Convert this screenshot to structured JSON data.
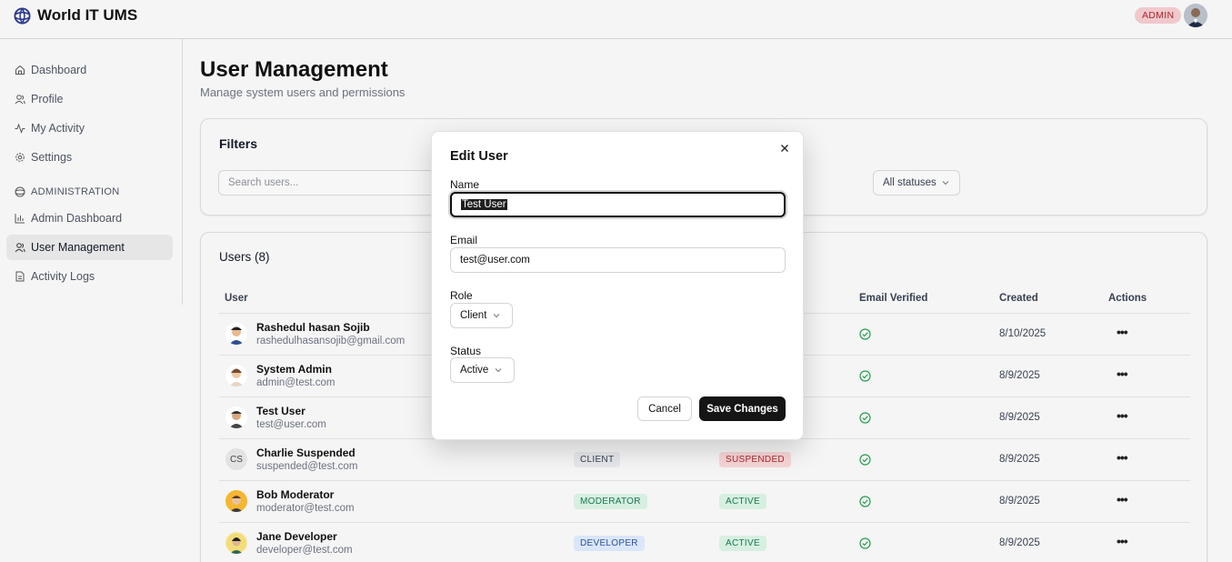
{
  "header": {
    "app_name": "World IT UMS",
    "role_badge": "ADMIN"
  },
  "sidebar": {
    "items": [
      {
        "label": "Dashboard"
      },
      {
        "label": "Profile"
      },
      {
        "label": "My Activity"
      },
      {
        "label": "Settings"
      }
    ],
    "section_label": "ADMINISTRATION",
    "admin_items": [
      {
        "label": "Admin Dashboard"
      },
      {
        "label": "User Management"
      },
      {
        "label": "Activity Logs"
      }
    ]
  },
  "main": {
    "title": "User Management",
    "subtitle": "Manage system users and permissions",
    "filters": {
      "title": "Filters",
      "search_placeholder": "Search users...",
      "status_value": "All statuses"
    },
    "users": {
      "title": "Users (8)",
      "columns": {
        "user": "User",
        "email_verified": "Email Verified",
        "created": "Created",
        "actions": "Actions"
      },
      "rows": [
        {
          "name": "Rashedul hasan Sojib",
          "email": "rashedulhasansojib@gmail.com",
          "role": "",
          "status": "",
          "created": "8/10/2025"
        },
        {
          "name": "System Admin",
          "email": "admin@test.com",
          "role": "",
          "status": "",
          "created": "8/9/2025"
        },
        {
          "name": "Test User",
          "email": "test@user.com",
          "role": "",
          "status": "",
          "created": "8/9/2025"
        },
        {
          "name": "Charlie Suspended",
          "email": "suspended@test.com",
          "initials": "CS",
          "role": "CLIENT",
          "status": "SUSPENDED",
          "created": "8/9/2025"
        },
        {
          "name": "Bob Moderator",
          "email": "moderator@test.com",
          "role": "MODERATOR",
          "status": "ACTIVE",
          "created": "8/9/2025"
        },
        {
          "name": "Jane Developer",
          "email": "developer@test.com",
          "role": "DEVELOPER",
          "status": "ACTIVE",
          "created": "8/9/2025"
        }
      ]
    }
  },
  "modal": {
    "title": "Edit User",
    "name_label": "Name",
    "name_value": "Test User",
    "email_label": "Email",
    "email_value": "test@user.com",
    "role_label": "Role",
    "role_value": "Client",
    "status_label": "Status",
    "status_value": "Active",
    "cancel_label": "Cancel",
    "save_label": "Save Changes"
  },
  "colors": {
    "primary": "#151515",
    "admin_badge_bg": "#f1c9cc",
    "admin_badge_text": "#b4232a",
    "success": "#22a04b"
  }
}
